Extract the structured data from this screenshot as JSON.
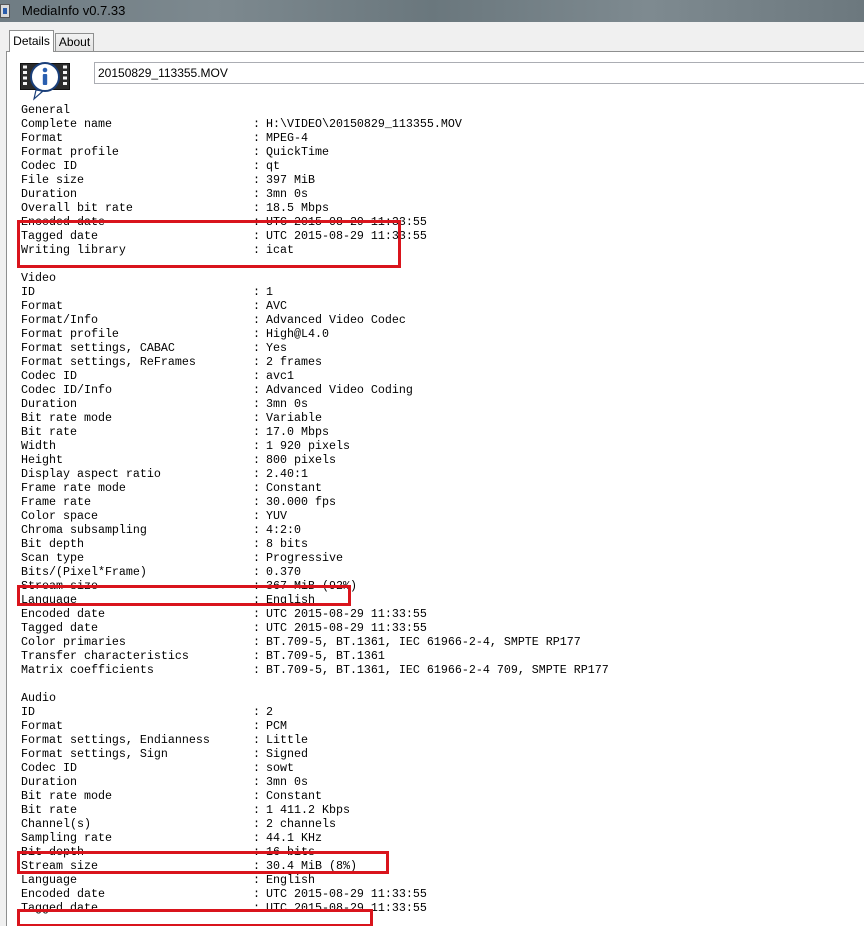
{
  "window": {
    "title": "MediaInfo v0.7.33"
  },
  "tabs": [
    {
      "label": "Details",
      "selected": true
    },
    {
      "label": "About",
      "selected": false
    }
  ],
  "file": {
    "name": "20150829_113355.MOV"
  },
  "icons": {
    "app": "mediainfo-app-icon",
    "file": "info-film-icon"
  },
  "colors": {
    "highlight": "#d9141c"
  },
  "sections": [
    {
      "title": "General",
      "fields": [
        {
          "label": "Complete name",
          "value": "H:\\VIDEO\\20150829_113355.MOV"
        },
        {
          "label": "Format",
          "value": "MPEG-4"
        },
        {
          "label": "Format profile",
          "value": "QuickTime"
        },
        {
          "label": "Codec ID",
          "value": "qt"
        },
        {
          "label": "File size",
          "value": "397 MiB"
        },
        {
          "label": "Duration",
          "value": "3mn 0s"
        },
        {
          "label": "Overall bit rate",
          "value": "18.5 Mbps"
        },
        {
          "label": "Encoded date",
          "value": "UTC 2015-08-29 11:33:55"
        },
        {
          "label": "Tagged date",
          "value": "UTC 2015-08-29 11:33:55"
        },
        {
          "label": "Writing library",
          "value": "icat"
        }
      ]
    },
    {
      "title": "Video",
      "fields": [
        {
          "label": "ID",
          "value": "1"
        },
        {
          "label": "Format",
          "value": "AVC"
        },
        {
          "label": "Format/Info",
          "value": "Advanced Video Codec"
        },
        {
          "label": "Format profile",
          "value": "High@L4.0"
        },
        {
          "label": "Format settings, CABAC",
          "value": "Yes"
        },
        {
          "label": "Format settings, ReFrames",
          "value": "2 frames"
        },
        {
          "label": "Codec ID",
          "value": "avc1"
        },
        {
          "label": "Codec ID/Info",
          "value": "Advanced Video Coding"
        },
        {
          "label": "Duration",
          "value": "3mn 0s"
        },
        {
          "label": "Bit rate mode",
          "value": "Variable"
        },
        {
          "label": "Bit rate",
          "value": "17.0 Mbps"
        },
        {
          "label": "Width",
          "value": "1 920 pixels"
        },
        {
          "label": "Height",
          "value": "800 pixels"
        },
        {
          "label": "Display aspect ratio",
          "value": "2.40:1"
        },
        {
          "label": "Frame rate mode",
          "value": "Constant"
        },
        {
          "label": "Frame rate",
          "value": "30.000 fps"
        },
        {
          "label": "Color space",
          "value": "YUV"
        },
        {
          "label": "Chroma subsampling",
          "value": "4:2:0"
        },
        {
          "label": "Bit depth",
          "value": "8 bits"
        },
        {
          "label": "Scan type",
          "value": "Progressive"
        },
        {
          "label": "Bits/(Pixel*Frame)",
          "value": "0.370"
        },
        {
          "label": "Stream size",
          "value": "367 MiB (92%)"
        },
        {
          "label": "Language",
          "value": "English"
        },
        {
          "label": "Encoded date",
          "value": "UTC 2015-08-29 11:33:55"
        },
        {
          "label": "Tagged date",
          "value": "UTC 2015-08-29 11:33:55"
        },
        {
          "label": "Color primaries",
          "value": "BT.709-5, BT.1361, IEC 61966-2-4, SMPTE RP177"
        },
        {
          "label": "Transfer characteristics",
          "value": "BT.709-5, BT.1361"
        },
        {
          "label": "Matrix coefficients",
          "value": "BT.709-5, BT.1361, IEC 61966-2-4 709, SMPTE RP177"
        }
      ]
    },
    {
      "title": "Audio",
      "fields": [
        {
          "label": "ID",
          "value": "2"
        },
        {
          "label": "Format",
          "value": "PCM"
        },
        {
          "label": "Format settings, Endianness",
          "value": "Little"
        },
        {
          "label": "Format settings, Sign",
          "value": "Signed"
        },
        {
          "label": "Codec ID",
          "value": "sowt"
        },
        {
          "label": "Duration",
          "value": "3mn 0s"
        },
        {
          "label": "Bit rate mode",
          "value": "Constant"
        },
        {
          "label": "Bit rate",
          "value": "1 411.2 Kbps"
        },
        {
          "label": "Channel(s)",
          "value": "2 channels"
        },
        {
          "label": "Sampling rate",
          "value": "44.1 KHz"
        },
        {
          "label": "Bit depth",
          "value": "16 bits"
        },
        {
          "label": "Stream size",
          "value": "30.4 MiB (8%)"
        },
        {
          "label": "Language",
          "value": "English"
        },
        {
          "label": "Encoded date",
          "value": "UTC 2015-08-29 11:33:55"
        },
        {
          "label": "Tagged date",
          "value": "UTC 2015-08-29 11:33:55"
        }
      ]
    }
  ],
  "separator": ":"
}
